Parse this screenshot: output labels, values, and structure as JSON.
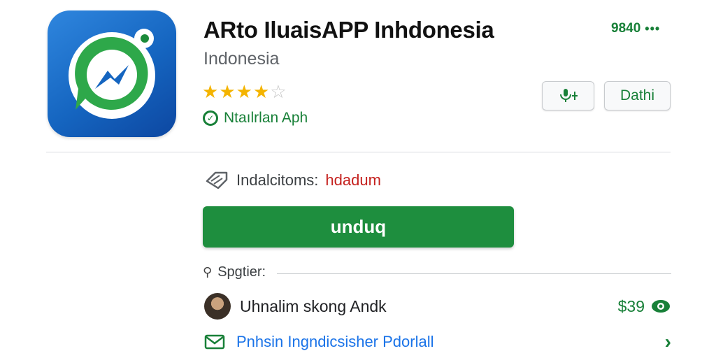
{
  "app": {
    "title": "ARto IluaisAPP Inhdonesia",
    "subtitle": "Indonesia",
    "rating": 4,
    "rating_max": 5,
    "verified_label": "Ntaılrlan Aph",
    "size": "9840",
    "size_more": "•••",
    "mic_label": "↓",
    "detail_label": "Dathi",
    "icon_name": "chat-bubble-app-icon"
  },
  "install": {
    "label": "Indalcitoms:",
    "value": "hdadum"
  },
  "download_button": {
    "label": "unduq"
  },
  "section": {
    "label": "Spgtier:"
  },
  "developer": {
    "name": "Uhnalim skong Andk",
    "price": "$39"
  },
  "contact": {
    "label": "Pnhsin Ingndicsisher Pdorlall"
  },
  "colors": {
    "accent_green": "#1e8e3e",
    "icon_blue": "#1565c0",
    "star": "#f4b400",
    "link_blue": "#1a73e8",
    "alert_red": "#c5221f"
  }
}
